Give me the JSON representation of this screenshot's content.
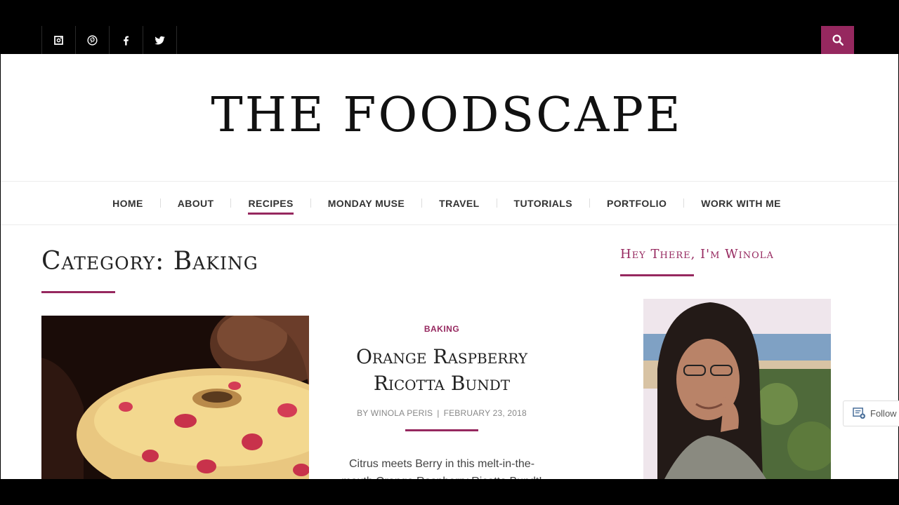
{
  "social": {
    "icons": [
      "instagram-icon",
      "pinterest-icon",
      "facebook-icon",
      "twitter-icon"
    ]
  },
  "site": {
    "title": "THE FOODSCAPE"
  },
  "nav": {
    "items": [
      {
        "label": "HOME"
      },
      {
        "label": "ABOUT"
      },
      {
        "label": "RECIPES",
        "active": true
      },
      {
        "label": "MONDAY MUSE"
      },
      {
        "label": "TRAVEL"
      },
      {
        "label": "TUTORIALS"
      },
      {
        "label": "PORTFOLIO"
      },
      {
        "label": "WORK WITH ME"
      }
    ]
  },
  "archive": {
    "title": "Category: Baking"
  },
  "post": {
    "category": "BAKING",
    "title": "Orange Raspberry Ricotta Bundt",
    "author": "BY WINOLA PERIS",
    "separator": "|",
    "date": "FEBRUARY 23, 2018",
    "excerpt": "Citrus meets Berry in this melt-in-the-mouth Orange Raspberry Ricotta Bundt!"
  },
  "sidebar": {
    "widget_title": "Hey There, I'm Winola"
  },
  "follow": {
    "label": "Follow"
  },
  "colors": {
    "accent": "#96285f",
    "topbar": "#000000",
    "page": "#ffffff"
  }
}
